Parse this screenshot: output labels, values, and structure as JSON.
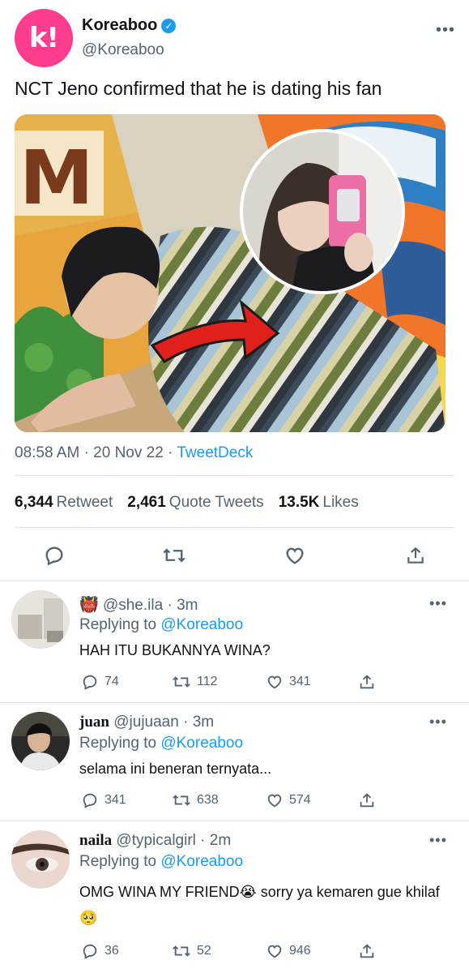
{
  "tweet": {
    "author_name": "Koreaboo",
    "author_handle": "@Koreaboo",
    "logo_letter": "k!",
    "text": "NCT Jeno confirmed that he is dating his fan",
    "time": "08:58 AM",
    "date": "20 Nov 22",
    "source": "TweetDeck",
    "retweets_count": "6,344",
    "retweets_label": "Retweet",
    "quotes_count": "2,461",
    "quotes_label": "Quote Tweets",
    "likes_count": "13.5K",
    "likes_label": "Likes",
    "more": "•••",
    "media_sign_text": "M"
  },
  "replies": [
    {
      "prefix_emoji": "👹",
      "name": "",
      "handle": "@she.ila",
      "time": "3m",
      "replying_label": "Replying to",
      "replying_to": "@Koreaboo",
      "text": "HAH ITU BUKANNYA WINA?",
      "replies": "74",
      "retweets": "112",
      "likes": "341"
    },
    {
      "prefix_emoji": "",
      "name": "juan",
      "handle": "@jujuaan",
      "time": "3m",
      "replying_label": "Replying to",
      "replying_to": "@Koreaboo",
      "text": "selama ini beneran ternyata...",
      "replies": "341",
      "retweets": "638",
      "likes": "574"
    },
    {
      "prefix_emoji": "",
      "name": "naila",
      "handle": "@typicalgirl",
      "time": "2m",
      "replying_label": "Replying to",
      "replying_to": "@Koreaboo",
      "text": "OMG WINA MY FRIEND😭  sorry ya kemaren gue khilaf🥺",
      "replies": "36",
      "retweets": "52",
      "likes": "946"
    }
  ],
  "colors": {
    "brand": "#ff3c8e",
    "link": "#1d9bf0",
    "muted": "#536471"
  },
  "icons": [
    "verified-badge-icon",
    "reply-icon",
    "retweet-icon",
    "like-icon",
    "share-icon",
    "more-icon"
  ]
}
